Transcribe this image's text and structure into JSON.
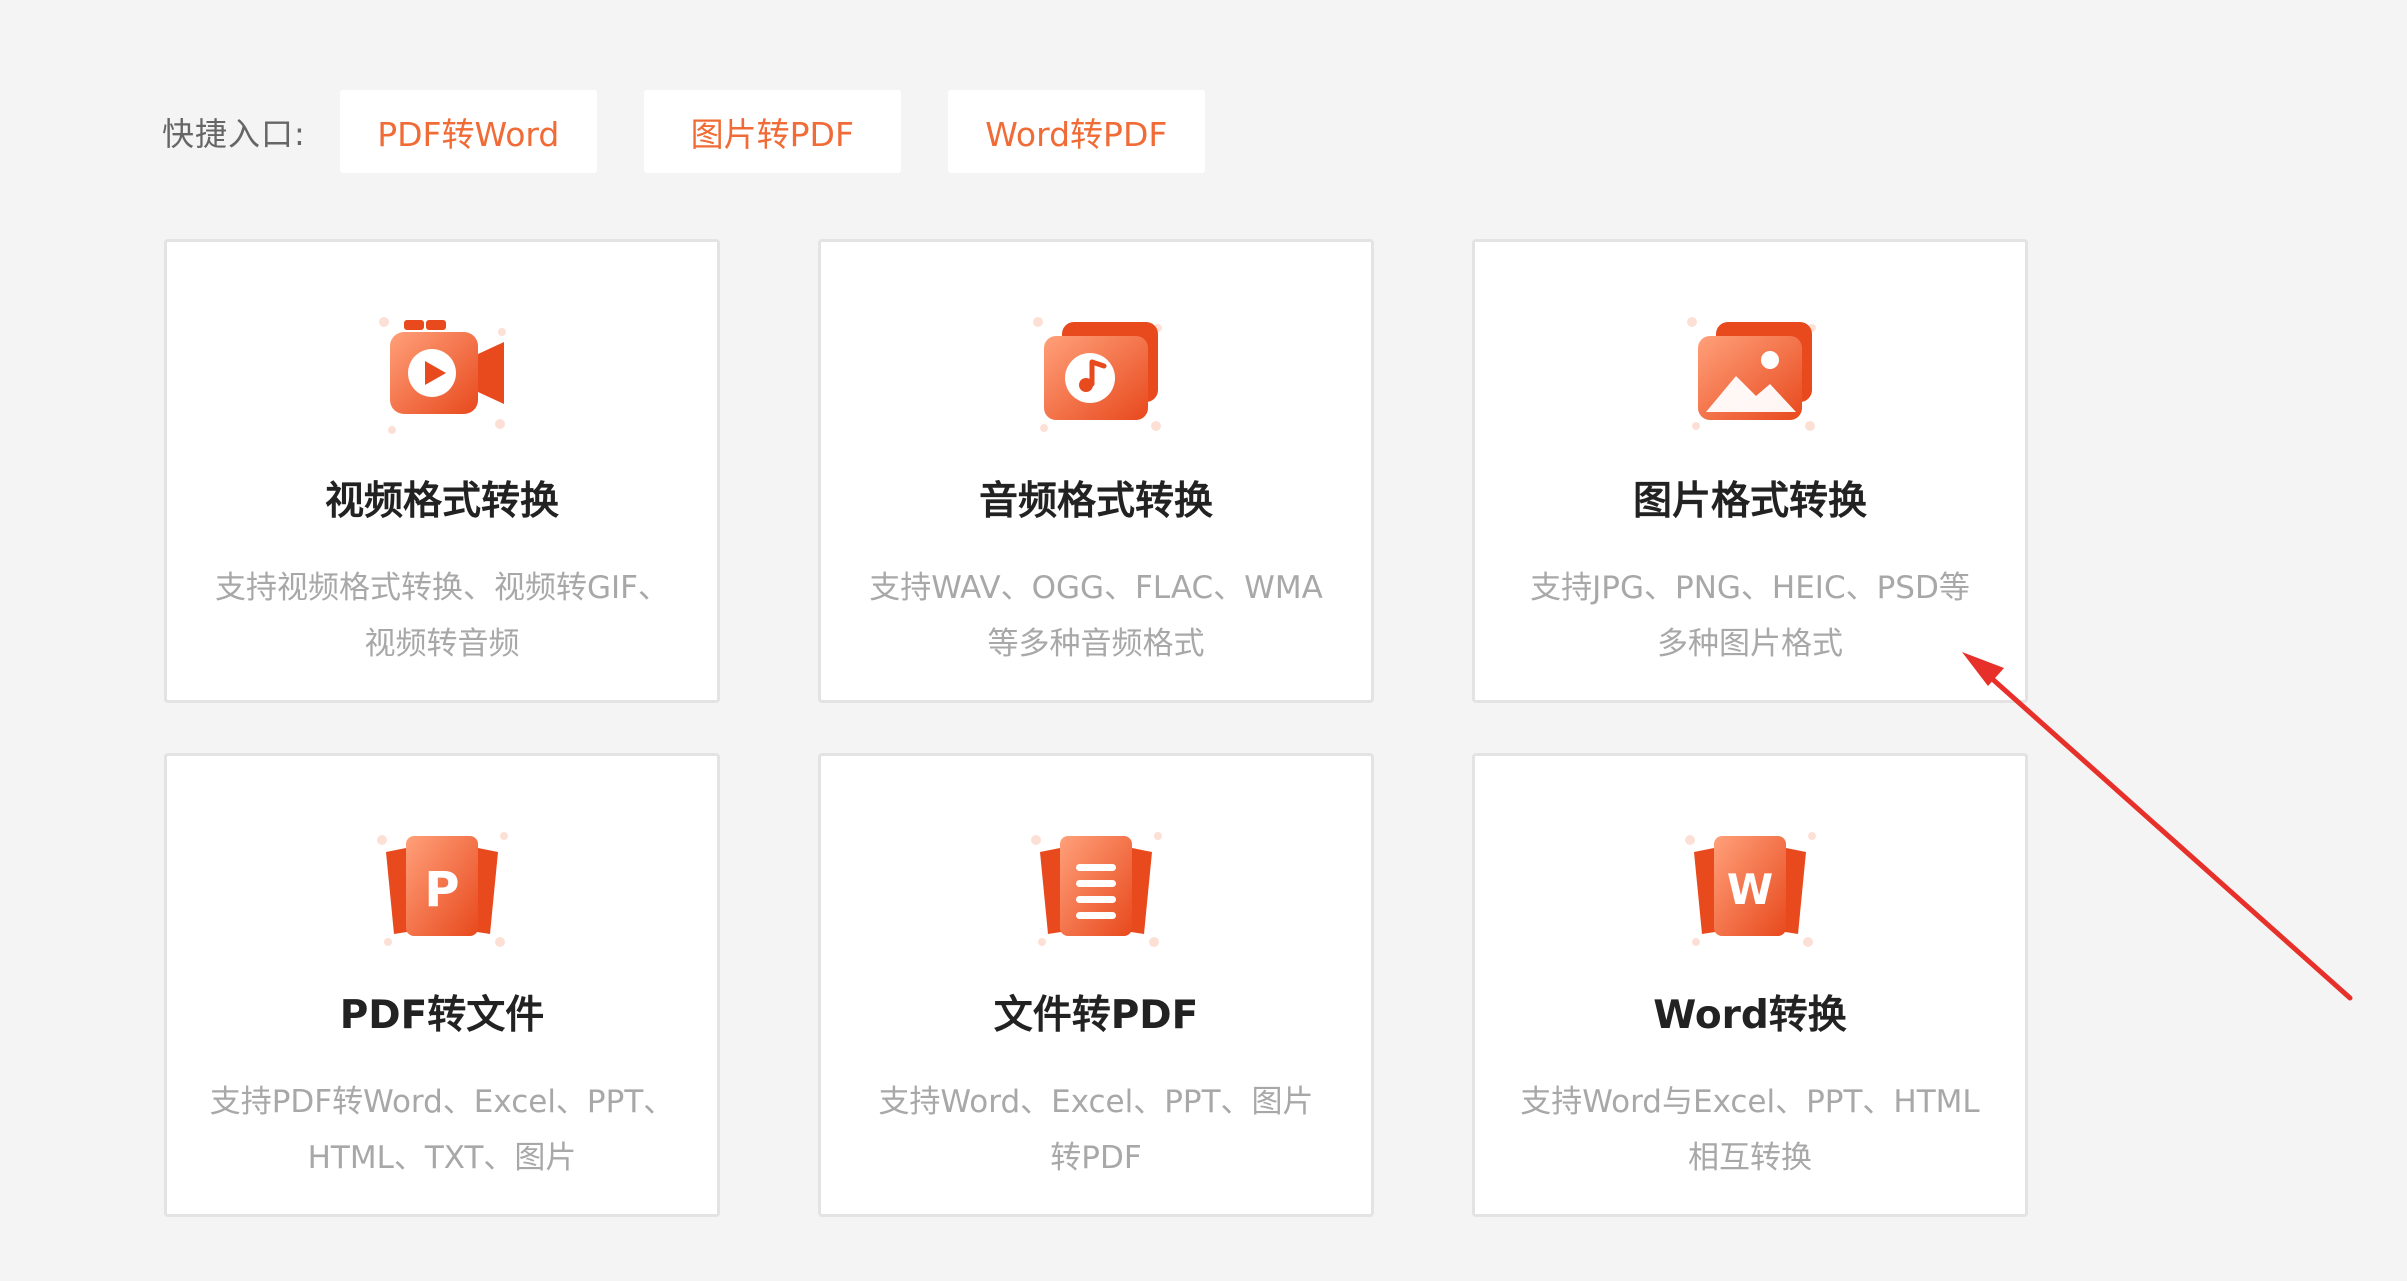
{
  "quick_entry": {
    "label": "快捷入口:",
    "buttons": [
      {
        "label": "PDF转Word"
      },
      {
        "label": "图片转PDF"
      },
      {
        "label": "Word转PDF"
      }
    ]
  },
  "cards": [
    {
      "icon": "video-camera-icon",
      "title": "视频格式转换",
      "description": "支持视频格式转换、视频转GIF、\n视频转音频"
    },
    {
      "icon": "music-note-icon",
      "title": "音频格式转换",
      "description": "支持WAV、OGG、FLAC、WMA\n等多种音频格式"
    },
    {
      "icon": "image-icon",
      "title": "图片格式转换",
      "description": "支持JPG、PNG、HEIC、PSD等\n多种图片格式"
    },
    {
      "icon": "pdf-p-icon",
      "title": "PDF转文件",
      "description": "支持PDF转Word、Excel、PPT、\nHTML、TXT、图片"
    },
    {
      "icon": "document-lines-icon",
      "title": "文件转PDF",
      "description": "支持Word、Excel、PPT、图片\n转PDF"
    },
    {
      "icon": "word-w-icon",
      "title": "Word转换",
      "description": "支持Word与Excel、PPT、HTML\n相互转换"
    }
  ],
  "colors": {
    "background": "#f4f4f4",
    "accent": "#f06b35",
    "icon_gradient_start": "#ff8a5c",
    "icon_gradient_end": "#e8491d",
    "annotation": "#e8302a"
  }
}
